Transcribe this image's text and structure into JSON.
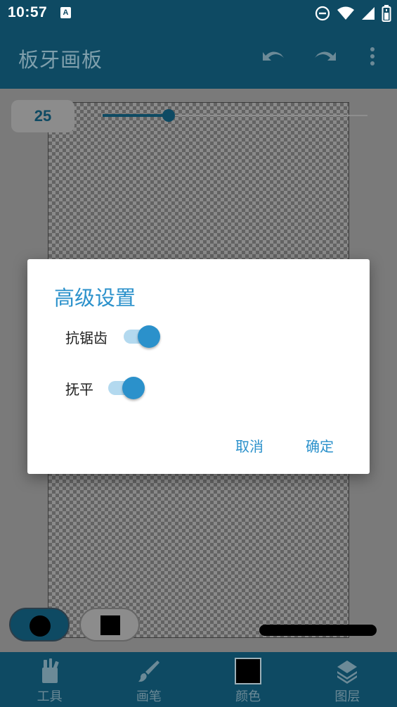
{
  "status_bar": {
    "time": "10:57",
    "notification_icon_letter": "A",
    "icons": [
      "do-not-disturb-icon",
      "wifi-icon",
      "signal-icon",
      "battery-icon"
    ]
  },
  "app_bar": {
    "title": "板牙画板",
    "actions": [
      "undo-icon",
      "redo-icon",
      "more-vert-icon"
    ]
  },
  "brush_size": {
    "value": "25",
    "slider_fraction": 0.25
  },
  "dialog": {
    "title": "高级设置",
    "options": [
      {
        "label": "抗锯齿",
        "enabled": true
      },
      {
        "label": "抚平",
        "enabled": true
      }
    ],
    "cancel_label": "取消",
    "confirm_label": "确定"
  },
  "tools": {
    "active": "brush",
    "items": [
      "brush-dot-tool",
      "eraser-square-tool"
    ]
  },
  "bottom_nav": {
    "items": [
      {
        "label": "工具",
        "icon": "tools-icon"
      },
      {
        "label": "画笔",
        "icon": "brush-icon"
      },
      {
        "label": "颜色",
        "icon": "color-swatch",
        "color": "#000000"
      },
      {
        "label": "图层",
        "icon": "layers-icon"
      }
    ]
  },
  "colors": {
    "primary": "#0e4a63",
    "accent": "#2b91cb",
    "switch_track": "#b3d9ef"
  }
}
